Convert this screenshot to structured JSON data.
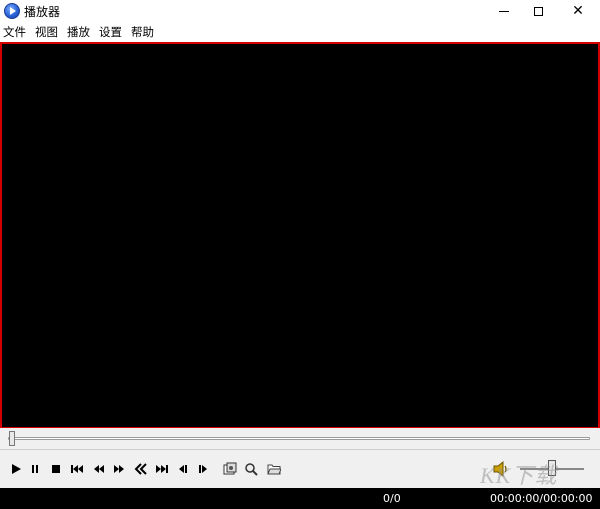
{
  "window": {
    "title": "播放器",
    "icon": "player-app-icon",
    "minimize_glyph": "minimize-icon",
    "maximize_glyph": "maximize-icon",
    "close_glyph": "✕"
  },
  "menu": [
    {
      "label": "文件"
    },
    {
      "label": "视图"
    },
    {
      "label": "播放"
    },
    {
      "label": "设置"
    },
    {
      "label": "帮助"
    }
  ],
  "video": {
    "background": "#000000",
    "border_color": "#d40000"
  },
  "seek": {
    "position": 0
  },
  "controls": {
    "buttons": [
      {
        "name": "play-icon"
      },
      {
        "name": "pause-icon"
      },
      {
        "name": "stop-icon"
      },
      {
        "name": "skip-to-start-icon"
      },
      {
        "name": "step-back-icon"
      },
      {
        "name": "step-forward-icon"
      },
      {
        "name": "rewind-icon"
      },
      {
        "name": "fast-forward-icon"
      },
      {
        "name": "previous-frame-icon"
      },
      {
        "name": "next-frame-icon"
      },
      {
        "name": "screenshot-icon"
      },
      {
        "name": "zoom-icon"
      },
      {
        "name": "open-folder-icon"
      }
    ],
    "volume_icon": "speaker-icon",
    "volume_level": 0.5
  },
  "status": {
    "count": "0/0",
    "time": "00:00:00/00:00:00"
  },
  "watermark": {
    "text": "KK下载"
  }
}
